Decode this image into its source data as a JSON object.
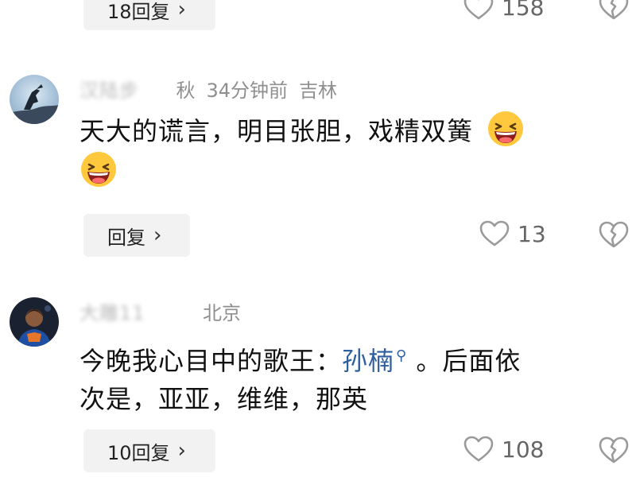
{
  "top_item": {
    "reply_label": "18回复",
    "likes": "158"
  },
  "comments": [
    {
      "name_blurred": "",
      "name_fragment": "秋",
      "time": "34分钟前",
      "location": "吉林",
      "text": "天大的谎言，明目张胆，戏精双簧",
      "reply_label": "回复",
      "likes": "13",
      "emoji": "laughing-face"
    },
    {
      "name_blurred": "大雕11",
      "name_fragment": "",
      "time": "",
      "location": "北京",
      "text_before": "今晚我心目中的歌王：",
      "mention": "孙楠",
      "text_after": " 。后面依",
      "text_line2": "次是，亚亚，维维，那英",
      "reply_label": "10回复",
      "likes": "108"
    }
  ],
  "colors": {
    "meta_gray": "#8f8f8f",
    "mention_blue": "#2f5f9e",
    "pill_bg": "#f2f2f2"
  }
}
